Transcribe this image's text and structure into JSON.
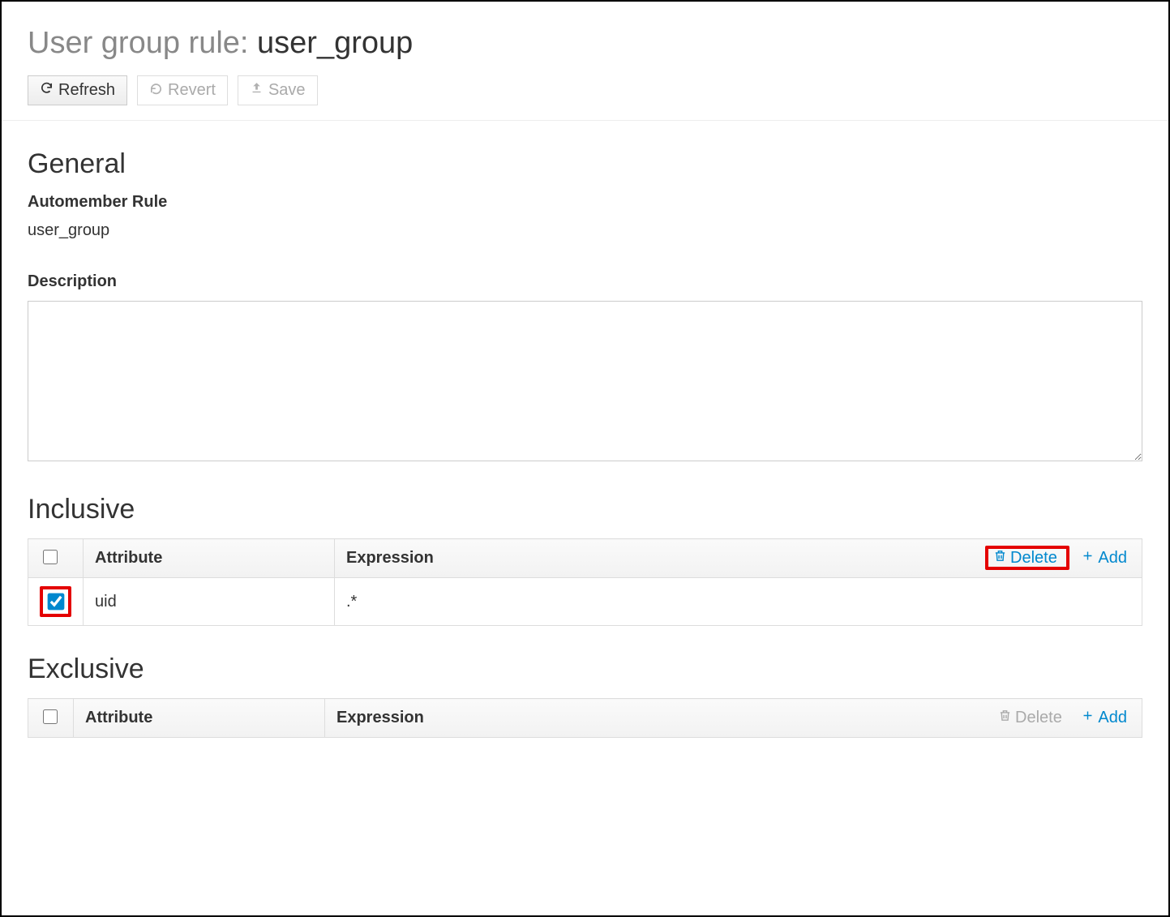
{
  "title": {
    "prefix": "User group rule: ",
    "name": "user_group"
  },
  "toolbar": {
    "refresh": "Refresh",
    "revert": "Revert",
    "save": "Save"
  },
  "general": {
    "heading": "General",
    "ruleLabel": "Automember Rule",
    "ruleValue": "user_group",
    "descLabel": "Description",
    "descValue": ""
  },
  "inclusive": {
    "heading": "Inclusive",
    "columns": {
      "attribute": "Attribute",
      "expression": "Expression"
    },
    "actions": {
      "delete": "Delete",
      "add": "Add"
    },
    "rows": [
      {
        "attribute": "uid",
        "expression": ".*",
        "checked": true
      }
    ]
  },
  "exclusive": {
    "heading": "Exclusive",
    "columns": {
      "attribute": "Attribute",
      "expression": "Expression"
    },
    "actions": {
      "delete": "Delete",
      "add": "Add"
    },
    "rows": []
  }
}
